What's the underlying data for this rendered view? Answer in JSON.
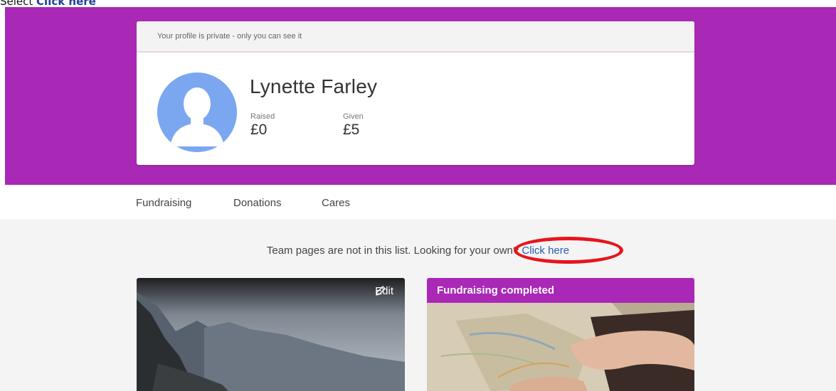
{
  "instruction": {
    "prefix": "Select ",
    "link_word": "Click here"
  },
  "profile": {
    "privacy_notice": "Your profile is private - only you can see it",
    "name": "Lynette Farley",
    "raised_label": "Raised",
    "raised_value": "£0",
    "given_label": "Given",
    "given_value": "£5",
    "avatar_icon": "default-user-avatar-icon"
  },
  "tabs": [
    {
      "label": "Fundraising"
    },
    {
      "label": "Donations"
    },
    {
      "label": "Cares"
    }
  ],
  "notice": {
    "text": "Team pages are not in this list. Looking for your own?",
    "link_label": "Click here"
  },
  "cards": [
    {
      "edit_label": "Edit",
      "edit_icon": "pencil-icon",
      "image": "mountain-landscape-photo"
    },
    {
      "status_label": "Fundraising completed",
      "image": "hand-holding-map-photo"
    }
  ],
  "colors": {
    "brand_purple": "#a928b6",
    "link_blue": "#2a5db0",
    "highlight_red": "#e8141c",
    "avatar_blue": "#7aa7f0"
  }
}
